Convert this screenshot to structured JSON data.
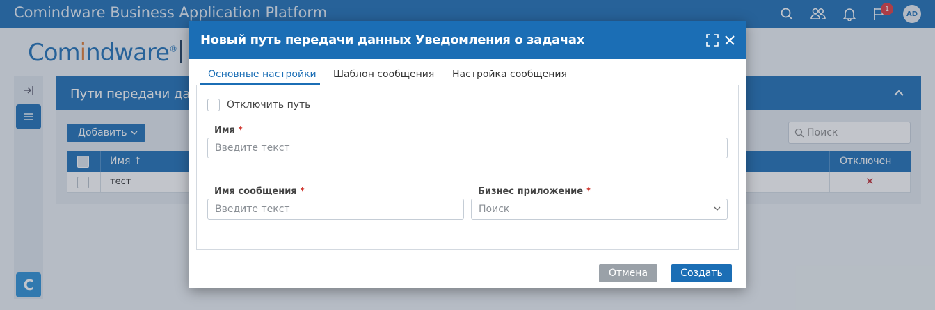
{
  "app": {
    "title": "Comindware Business Application Platform",
    "logo_part1": "Com",
    "logo_part2": "i",
    "logo_part3": "ndware",
    "logo_reg": "®",
    "notifications_count": "1",
    "avatar_initials": "AD"
  },
  "background": {
    "panel_title": "Пути передачи данных",
    "add_button": "Добавить",
    "search_placeholder": "Поиск",
    "grid": {
      "columns": [
        "Имя ↑",
        "Отключен"
      ],
      "rows": [
        {
          "name": "тест",
          "disabled": "✕"
        }
      ]
    }
  },
  "dialog": {
    "title": "Новый путь передачи данных Уведомления о задачах",
    "tabs": [
      "Основные настройки",
      "Шаблон сообщения",
      "Настройка сообщения"
    ],
    "disable_label": "Отключить путь",
    "name_label": "Имя",
    "name_placeholder": "Введите текст",
    "message_name_label": "Имя сообщения",
    "message_name_placeholder": "Введите текст",
    "business_app_label": "Бизнес приложение",
    "business_app_placeholder": "Поиск",
    "required_mark": "*",
    "cancel_button": "Отмена",
    "create_button": "Создать"
  },
  "colors": {
    "brand": "#1b6eb5",
    "accent": "#e07a2f",
    "cancel": "#9aa1a8",
    "required": "#d0342c"
  }
}
